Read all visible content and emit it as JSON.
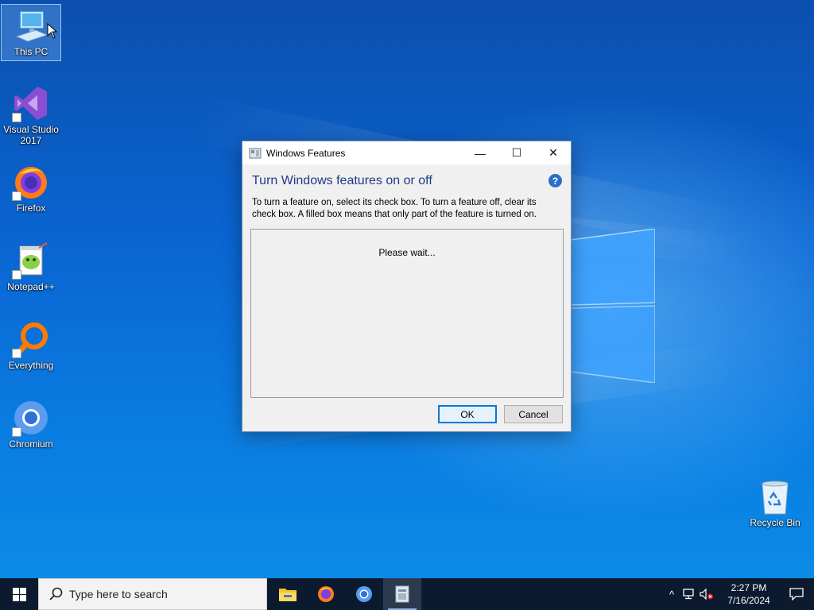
{
  "desktop": {
    "icons": [
      {
        "label": "This PC",
        "icon": "computer-icon"
      },
      {
        "label": "Visual Studio\n2017",
        "icon": "visual-studio-icon"
      },
      {
        "label": "Firefox",
        "icon": "firefox-icon"
      },
      {
        "label": "Notepad++",
        "icon": "notepad-plus-plus-icon"
      },
      {
        "label": "Everything",
        "icon": "everything-search-icon"
      },
      {
        "label": "Chromium",
        "icon": "chromium-icon"
      },
      {
        "label": "Recycle Bin",
        "icon": "recycle-bin-icon"
      }
    ]
  },
  "dialog": {
    "title": "Windows Features",
    "heading": "Turn Windows features on or off",
    "description": "To turn a feature on, select its check box. To turn a feature off, clear its check box. A filled box means that only part of the feature is turned on.",
    "status": "Please wait...",
    "ok_label": "OK",
    "cancel_label": "Cancel",
    "help_glyph": "?",
    "minimize_glyph": "—",
    "maximize_glyph": "☐",
    "close_glyph": "✕"
  },
  "taskbar": {
    "search_placeholder": "Type here to search",
    "pinned": [
      "file-explorer-icon",
      "firefox-icon",
      "chromium-icon",
      "windows-features-icon"
    ],
    "tray": {
      "chevron_glyph": "^",
      "time": "2:27 PM",
      "date": "7/16/2024"
    }
  },
  "colors": {
    "accent": "#0078d7",
    "heading": "#1e3a8a",
    "taskbar": "#0b1a2e"
  }
}
